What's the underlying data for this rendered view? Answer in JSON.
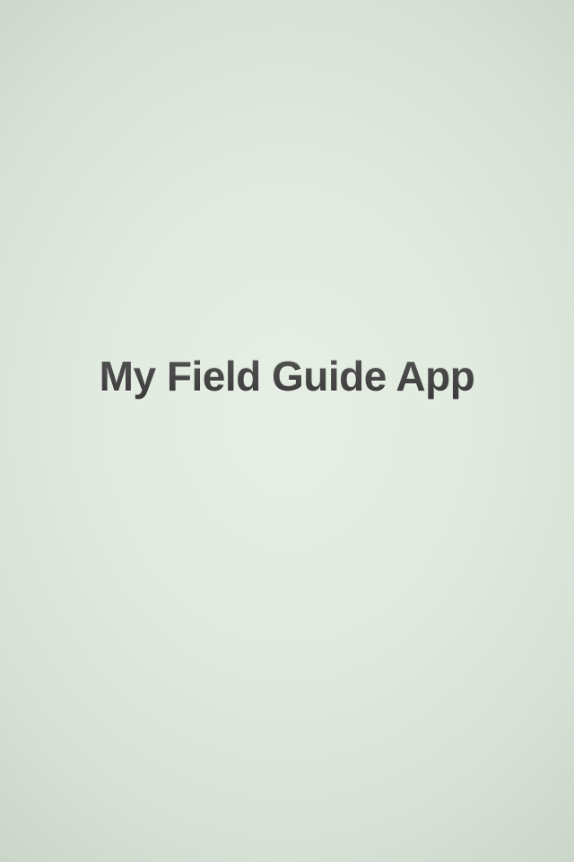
{
  "splash": {
    "title": "My Field Guide App"
  },
  "colors": {
    "background_center": "#e6efe4",
    "background_edge": "#c6d1c5",
    "title_text": "#444444"
  }
}
